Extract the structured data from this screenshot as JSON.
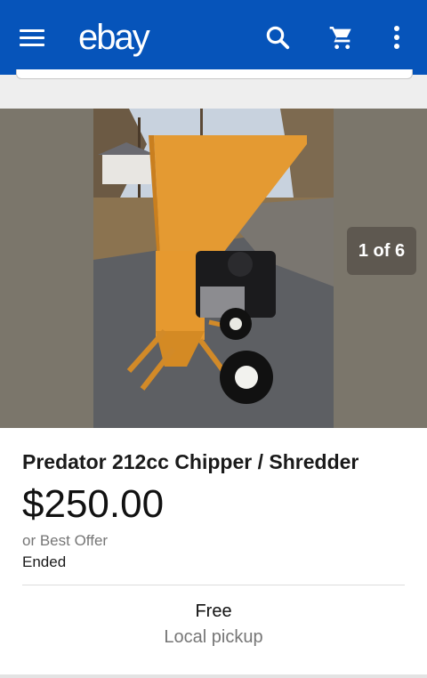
{
  "header": {
    "brand": "ebay",
    "icons": [
      "menu-icon",
      "search-icon",
      "cart-icon",
      "more-vert-icon"
    ],
    "bar_color": "#0654ba"
  },
  "gallery": {
    "counter": "1 of 6",
    "image_subject": "orange chipper shredder on driveway"
  },
  "listing": {
    "title": "Predator 212cc Chipper / Shredder",
    "price": "$250.00",
    "offer_note": "or Best Offer",
    "status": "Ended"
  },
  "shipping": {
    "cost": "Free",
    "method": "Local pickup"
  }
}
